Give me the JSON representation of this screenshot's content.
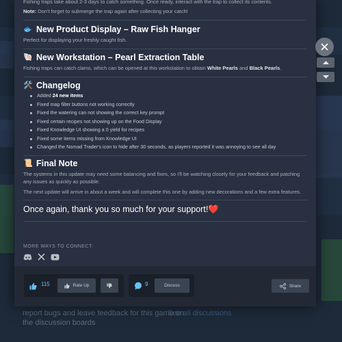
{
  "background": {
    "bottom_text_1": "report bugs and leave feedback for this game on",
    "bottom_text_2": "the discussion boards",
    "bottom_link": "See all discussions"
  },
  "post": {
    "intro_line": "Fishing traps take about 2-3 days to catch something. Once ready, interact with the trap to collect its contents.",
    "note_label": "Note:",
    "note_text": "Don't forget to submerge the trap again after collecting your catch!",
    "section_hanger": {
      "emoji": "🐟",
      "title": "New Product Display – Raw Fish Hanger",
      "text": "Perfect for displaying your freshly caught fish."
    },
    "section_pearl": {
      "emoji": "🐚",
      "title": "New Workstation – Pearl Extraction Table",
      "text_before": "Fishing traps can catch clams, which can be opened at this workstation to obtain",
      "white_pearls": "White Pearls",
      "and": "and",
      "black_pearls": "Black Pearls",
      "end": "."
    },
    "changelog": {
      "emoji": "🛠️",
      "title": "Changelog",
      "first_prefix": "Added",
      "first_bold": "24 new items",
      "items": [
        "Fixed map filter buttons not working correctly",
        "Fixed the watering can not showing the correct key prompt",
        "Fixed certain recipes not showing up on the Food Display",
        "Fixed Knowledge UI showing a 0 yield for recipes",
        "Fixed some items missing from Knowledge UI",
        "Changed the Nomad Trader's icon to hide after 30 seconds, as players reported it was annoying to see all day"
      ]
    },
    "final_note": {
      "emoji": "📜",
      "title": "Final Note",
      "p1": "The systems in this update may need some balancing and fixes, so I'll be watching closely for your feedback and patching any issues as quickly as possible.",
      "p2": "The next update will arrive in about a week and will complete this one by adding new decorations and a few extra features."
    },
    "thanks": "Once again, thank you so much for your support!",
    "thanks_emoji": "❤️",
    "connect_label": "MORE WAYS TO CONNECT:"
  },
  "footer": {
    "likes": "115",
    "rate_up": "Rate Up",
    "comments": "9",
    "discuss": "Discuss",
    "share": "Share"
  },
  "colors": {
    "accent": "#66c0f4",
    "modal_bg": "#283041"
  }
}
